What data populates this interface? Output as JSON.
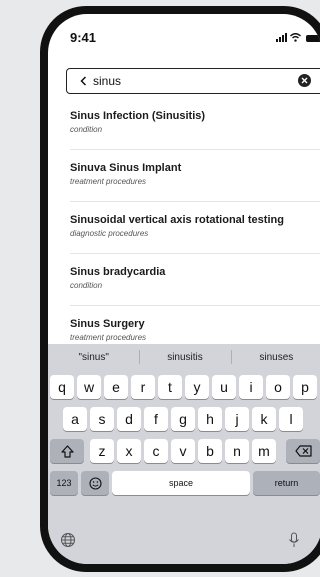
{
  "status_bar": {
    "time": "9:41"
  },
  "search": {
    "back_icon": "chevron-left-icon",
    "value": "sinus",
    "clear_icon": "clear-circle-icon"
  },
  "results": [
    {
      "name": "Sinus Infection (Sinusitis)",
      "category": "condition"
    },
    {
      "name": "Sinuva Sinus Implant",
      "category": "treatment procedures"
    },
    {
      "name": "Sinusoidal vertical axis rotational testing",
      "category": "diagnostic procedures"
    },
    {
      "name": "Sinus bradycardia",
      "category": "condition"
    },
    {
      "name": "Sinus Surgery",
      "category": "treatment procedures"
    }
  ],
  "keyboard": {
    "suggestions": [
      "\"sinus\"",
      "sinusitis",
      "sinuses"
    ],
    "row1": [
      "q",
      "w",
      "e",
      "r",
      "t",
      "y",
      "u",
      "i",
      "o",
      "p"
    ],
    "row2": [
      "a",
      "s",
      "d",
      "f",
      "g",
      "h",
      "j",
      "k",
      "l"
    ],
    "row3": [
      "z",
      "x",
      "c",
      "v",
      "b",
      "n",
      "m"
    ],
    "shift_icon": "shift-icon",
    "backspace_icon": "backspace-icon",
    "numbers_label": "123",
    "emoji_icon": "emoji-icon",
    "space_label": "space",
    "return_label": "return",
    "globe_icon": "globe-icon",
    "mic_icon": "microphone-icon"
  }
}
